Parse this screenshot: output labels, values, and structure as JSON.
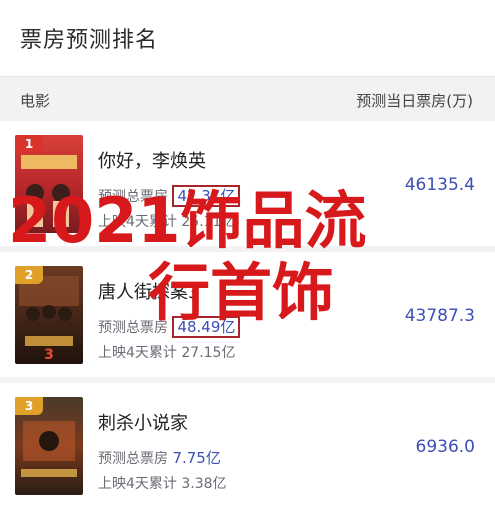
{
  "header": {
    "title": "票房预测排名"
  },
  "columns": {
    "left": "电影",
    "right": "预测当日票房(万)"
  },
  "movies": [
    {
      "rank": "1",
      "name": "你好，李焕英",
      "pred_label": "预测总票房",
      "pred_value": "42.37亿",
      "cum_label": "上映4天累计",
      "cum_value": "25.11亿",
      "today": "46135.4",
      "poster_color": "#c0282d",
      "rank_color": "#d9342b"
    },
    {
      "rank": "2",
      "name": "唐人街探案3",
      "pred_label": "预测总票房",
      "pred_value": "48.49亿",
      "cum_label": "上映4天累计",
      "cum_value": "27.15亿",
      "today": "43787.3",
      "poster_color": "#5a2f1f",
      "rank_color": "#e0a12a"
    },
    {
      "rank": "3",
      "name": "刺杀小说家",
      "pred_label": "预测总票房",
      "pred_value": "7.75亿",
      "cum_label": "上映4天累计",
      "cum_value": "3.38亿",
      "today": "6936.0",
      "poster_color": "#3b2a1e",
      "rank_color": "#e0a12a"
    }
  ],
  "watermark": {
    "line1": "2021饰品流",
    "line2": "行首饰"
  }
}
